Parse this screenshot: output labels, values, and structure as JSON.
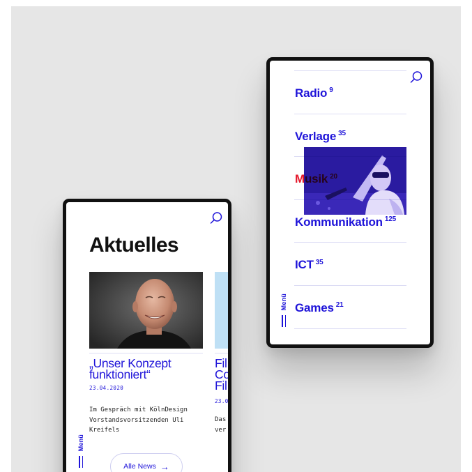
{
  "left_screen": {
    "title": "Aktuelles",
    "menu_label": "Menü",
    "cards": [
      {
        "title_lines": [
          "„Unser Konzept",
          "funktioniert“"
        ],
        "date": "23.04.2020",
        "text_lines": [
          "Im Gespräch mit KölnDesign",
          "Vorstandsvorsitzenden Uli",
          "Kreifels"
        ]
      },
      {
        "title_lines": [
          "Fil",
          "Co",
          "Fil"
        ],
        "date": "23.0",
        "text_lines": [
          "Das",
          "ver"
        ]
      }
    ],
    "all_news_label": "Alle News",
    "arrow_glyph": "→"
  },
  "right_screen": {
    "menu_label": "Menü",
    "categories": [
      {
        "label": "Radio",
        "count": "9"
      },
      {
        "label": "Verlage",
        "count": "35"
      },
      {
        "label": "Musik",
        "count": "20"
      },
      {
        "label": "Kommunikation",
        "count": "125"
      },
      {
        "label": "ICT",
        "count": "35"
      },
      {
        "label": "Games",
        "count": "21"
      }
    ],
    "active_category": "Musik"
  },
  "colors": {
    "brand_blue": "#1f14d9",
    "active_red": "#e5172b",
    "background": "#e6e6e6",
    "frame": "#111111"
  }
}
